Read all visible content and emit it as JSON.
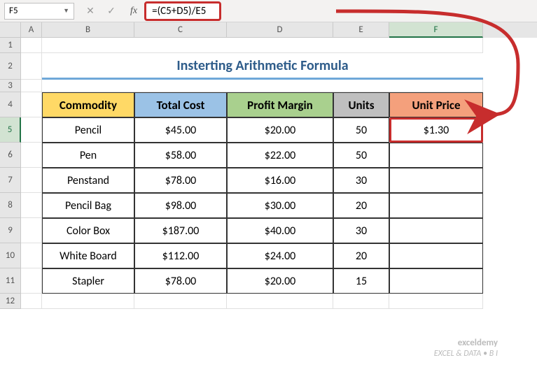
{
  "namebox": "F5",
  "formula": "=(C5+D5)/E5",
  "fx_label": "fx",
  "title": "Insterting Arithmetic Formula",
  "columns": [
    "",
    "A",
    "B",
    "C",
    "D",
    "E",
    "F"
  ],
  "row_numbers": [
    "1",
    "2",
    "3",
    "4",
    "5",
    "6",
    "7",
    "8",
    "9",
    "10",
    "11",
    "12"
  ],
  "headers": {
    "commodity": "Commodity",
    "totalcost": "Total Cost",
    "margin": "Profit Margin",
    "units": "Units",
    "unitprice": "Unit Price"
  },
  "rows": [
    {
      "commodity": "Pencil",
      "totalcost": "$45.00",
      "margin": "$20.00",
      "units": "50",
      "unitprice": "$1.30"
    },
    {
      "commodity": "Pen",
      "totalcost": "$58.00",
      "margin": "$22.00",
      "units": "50",
      "unitprice": ""
    },
    {
      "commodity": "Penstand",
      "totalcost": "$78.00",
      "margin": "$16.00",
      "units": "30",
      "unitprice": ""
    },
    {
      "commodity": "Pencil Bag",
      "totalcost": "$98.00",
      "margin": "$30.00",
      "units": "20",
      "unitprice": ""
    },
    {
      "commodity": "Color Box",
      "totalcost": "$187.00",
      "margin": "$40.00",
      "units": "30",
      "unitprice": ""
    },
    {
      "commodity": "White Board",
      "totalcost": "$112.00",
      "margin": "$24.00",
      "units": "20",
      "unitprice": ""
    },
    {
      "commodity": "Stapler",
      "totalcost": "$78.00",
      "margin": "$20.00",
      "units": "15",
      "unitprice": ""
    }
  ],
  "watermark": {
    "l1": "exceldemy",
    "l2": "EXCEL & DATA • B I"
  },
  "chart_data": {
    "type": "table",
    "title": "Insterting Arithmetic Formula",
    "columns": [
      "Commodity",
      "Total Cost",
      "Profit Margin",
      "Units",
      "Unit Price"
    ],
    "data": [
      [
        "Pencil",
        45.0,
        20.0,
        50,
        1.3
      ],
      [
        "Pen",
        58.0,
        22.0,
        50,
        null
      ],
      [
        "Penstand",
        78.0,
        16.0,
        30,
        null
      ],
      [
        "Pencil Bag",
        98.0,
        30.0,
        20,
        null
      ],
      [
        "Color Box",
        187.0,
        40.0,
        30,
        null
      ],
      [
        "White Board",
        112.0,
        24.0,
        20,
        null
      ],
      [
        "Stapler",
        78.0,
        20.0,
        15,
        null
      ]
    ],
    "active_cell": "F5",
    "formula": "=(C5+D5)/E5"
  }
}
